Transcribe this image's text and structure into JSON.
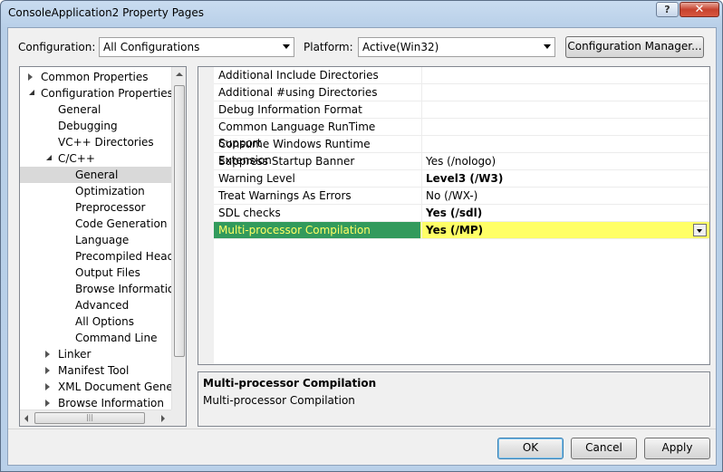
{
  "window": {
    "title": "ConsoleApplication2 Property Pages",
    "help_label": "?",
    "close_label": "✕"
  },
  "toolbar": {
    "configuration_label": "Configuration:",
    "configuration_value": "All Configurations",
    "platform_label": "Platform:",
    "platform_value": "Active(Win32)",
    "config_manager_label": "Configuration Manager..."
  },
  "tree": {
    "items": [
      {
        "label": "Common Properties",
        "expander": "closed"
      },
      {
        "label": "Configuration Properties",
        "expander": "open"
      },
      {
        "label": "General"
      },
      {
        "label": "Debugging"
      },
      {
        "label": "VC++ Directories"
      },
      {
        "label": "C/C++",
        "expander": "open"
      },
      {
        "label": "General",
        "selected": true
      },
      {
        "label": "Optimization"
      },
      {
        "label": "Preprocessor"
      },
      {
        "label": "Code Generation"
      },
      {
        "label": "Language"
      },
      {
        "label": "Precompiled Heade"
      },
      {
        "label": "Output Files"
      },
      {
        "label": "Browse Information"
      },
      {
        "label": "Advanced"
      },
      {
        "label": "All Options"
      },
      {
        "label": "Command Line"
      },
      {
        "label": "Linker",
        "expander": "closed"
      },
      {
        "label": "Manifest Tool",
        "expander": "closed"
      },
      {
        "label": "XML Document Genera",
        "expander": "closed"
      },
      {
        "label": "Browse Information",
        "expander": "closed"
      }
    ],
    "hscroll_grip": "|||"
  },
  "grid": {
    "rows": [
      {
        "name": "Additional Include Directories",
        "value": ""
      },
      {
        "name": "Additional #using Directories",
        "value": ""
      },
      {
        "name": "Debug Information Format",
        "value": ""
      },
      {
        "name": "Common Language RunTime Support",
        "value": ""
      },
      {
        "name": "Consume Windows Runtime Extension",
        "value": ""
      },
      {
        "name": "Suppress Startup Banner",
        "value": "Yes (/nologo)"
      },
      {
        "name": "Warning Level",
        "value": "Level3 (/W3)",
        "bold": true
      },
      {
        "name": "Treat Warnings As Errors",
        "value": "No (/WX-)"
      },
      {
        "name": "SDL checks",
        "value": "Yes (/sdl)",
        "bold": true
      },
      {
        "name": "Multi-processor Compilation",
        "value": "Yes (/MP)",
        "bold": true,
        "highlight": true
      }
    ]
  },
  "description": {
    "title": "Multi-processor Compilation",
    "body": "Multi-processor Compilation"
  },
  "buttons": {
    "ok": "OK",
    "cancel": "Cancel",
    "apply": "Apply"
  },
  "colors": {
    "highlight_row": "#ffff66",
    "highlight_name_bg": "#329a5c",
    "title_bar": "#b9d0e9"
  }
}
